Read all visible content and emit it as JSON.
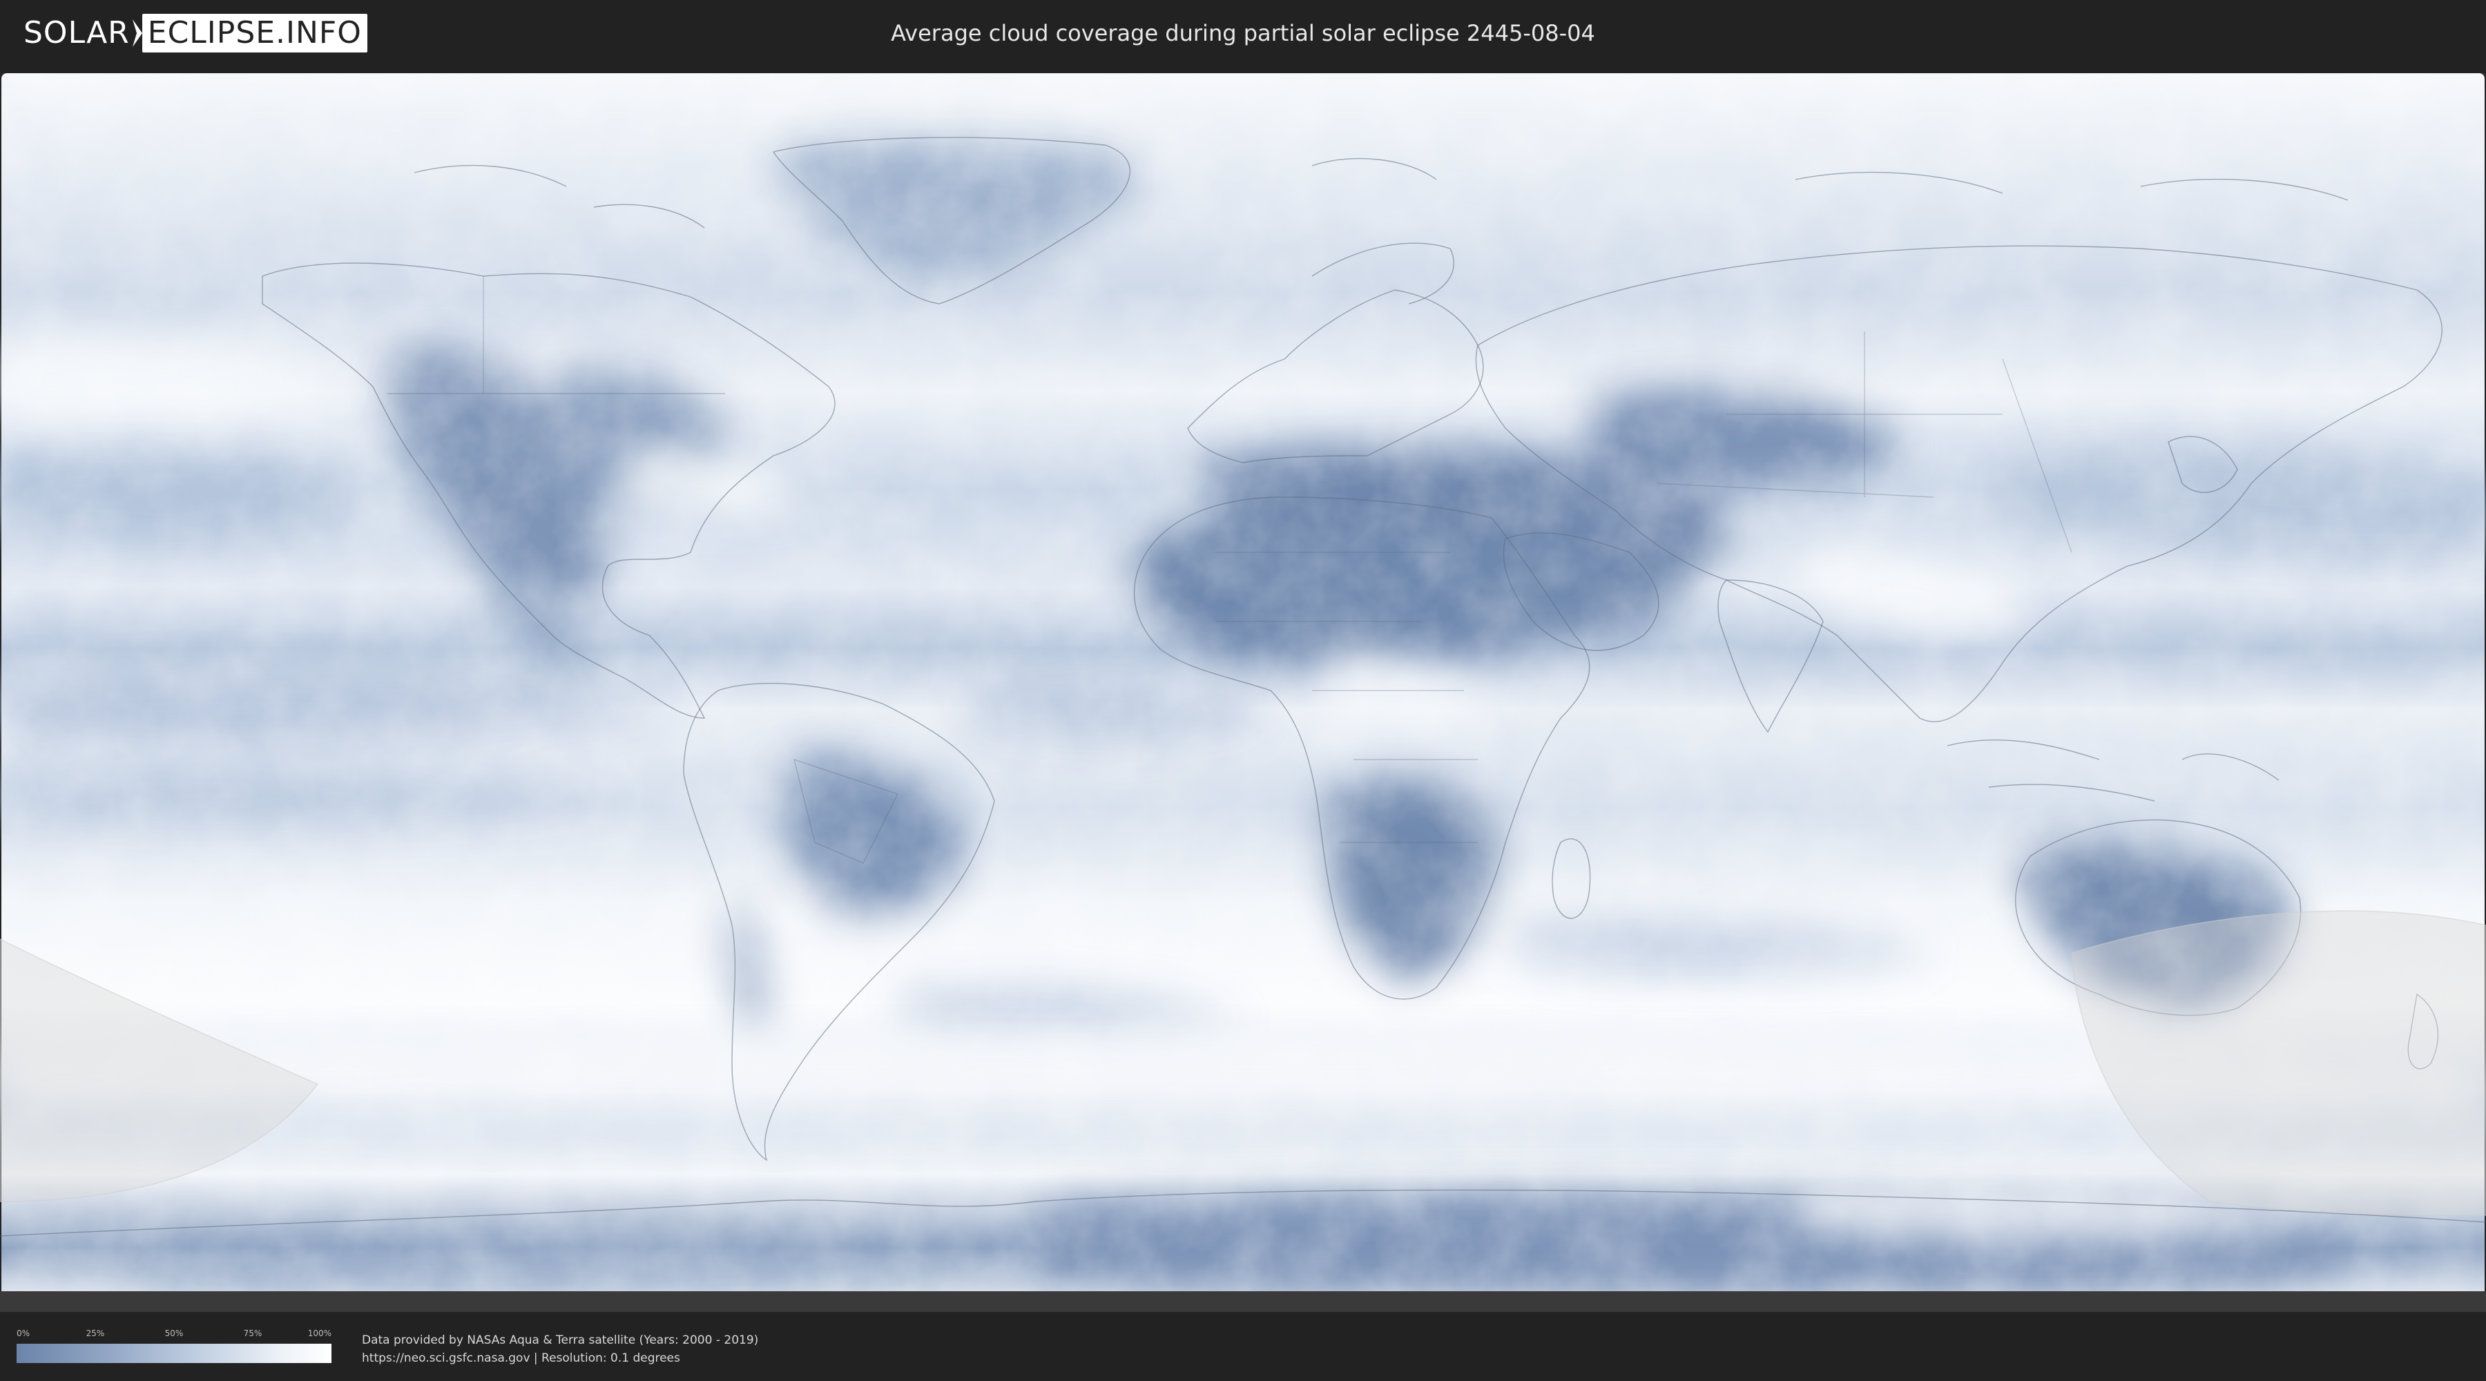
{
  "header": {
    "logo_part1": "SOLAR",
    "logo_part2": "ECLIPSE.INFO",
    "title": "Average cloud coverage during partial solar eclipse 2445-08-04"
  },
  "map": {
    "colors": {
      "clear": "#5f7aa3",
      "mid": "#a9bcd6",
      "cloudy": "#f4f7fb",
      "border_line": "#5d6b80",
      "eclipse_shade": "#d8d8d8",
      "frame": "#222222"
    }
  },
  "legend": {
    "ticks": [
      "0%",
      "25%",
      "50%",
      "75%",
      "100%"
    ],
    "gradient_colors": [
      "#6b84aa",
      "#94a8c6",
      "#c4d2e3",
      "#eef3f8",
      "#ffffff"
    ]
  },
  "credits": {
    "line1": "Data provided by NASAs Aqua & Terra satellite (Years: 2000 - 2019)",
    "line2": "https://neo.sci.gsfc.nasa.gov | Resolution: 0.1 degrees"
  }
}
